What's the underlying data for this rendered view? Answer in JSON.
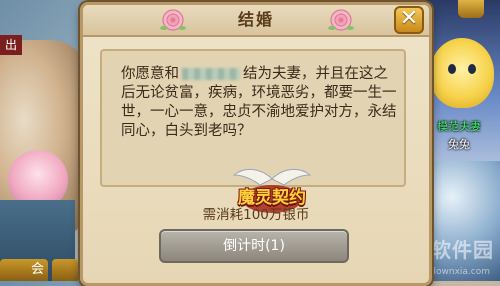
{
  "dialog": {
    "title": "结婚",
    "close_label": "✕",
    "vow_prefix": "你愿意和",
    "vow_body": "结为夫妻，并且在这之后无论贫富，疾病，环境恶劣，都要一生一世，一心一意，忠贞不渝地爱护对方，永结同心，白头到老吗？",
    "logo_text": "魔灵契约",
    "cost_text": "需消耗100万银币",
    "confirm_button": "倒计时(1)"
  },
  "scene": {
    "left_tag": "出",
    "left_button": "会",
    "npc_title": "模范夫妻",
    "npc_name": "兔兔",
    "watermark": "当下软件园",
    "watermark_sub": "www.downxia.com"
  },
  "colors": {
    "dialog_bg": "#efe4c9",
    "dialog_border": "#b89866",
    "close_button": "#e0a93a",
    "confirm_button_disabled": "#a39e95",
    "text": "#3a2a1a"
  }
}
